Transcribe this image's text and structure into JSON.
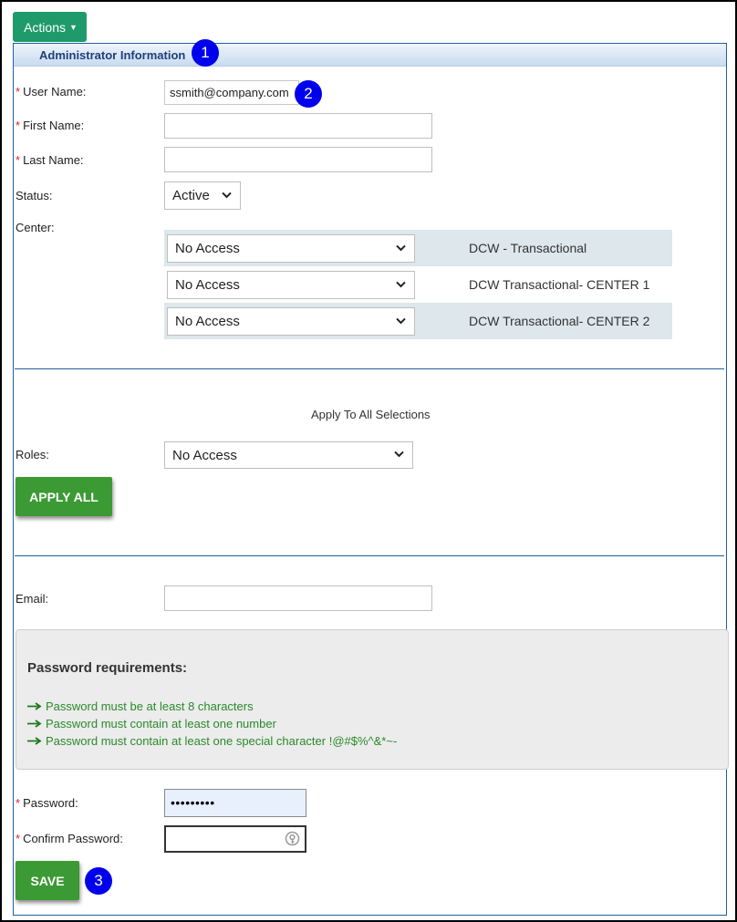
{
  "toolbar": {
    "actions_label": "Actions",
    "actions_caret": "▼"
  },
  "panel": {
    "title": "Administrator Information"
  },
  "callouts": {
    "one": "1",
    "two": "2",
    "three": "3"
  },
  "form": {
    "required_mark": "*",
    "username": {
      "label": "User Name:",
      "value": "ssmith@company.com"
    },
    "first_name": {
      "label": "First Name:",
      "value": ""
    },
    "last_name": {
      "label": "Last Name:",
      "value": ""
    },
    "status": {
      "label": "Status:",
      "value": "Active"
    },
    "center": {
      "label": "Center:",
      "rows": [
        {
          "access": "No Access",
          "name": "DCW - Transactional"
        },
        {
          "access": "No Access",
          "name": "DCW Transactional- CENTER 1"
        },
        {
          "access": "No Access",
          "name": "DCW Transactional- CENTER 2"
        }
      ]
    },
    "apply_all_heading": "Apply To All Selections",
    "roles": {
      "label": "Roles:",
      "value": "No Access"
    },
    "apply_all_button": "APPLY ALL",
    "email": {
      "label": "Email:",
      "value": ""
    },
    "password_requirements": {
      "title": "Password requirements:",
      "items": [
        "Password must be at least 8 characters",
        "Password must contain at least one number",
        "Password must contain at least one special character !@#$%^&*~-"
      ]
    },
    "password": {
      "label": "Password:",
      "value": "•••••••••"
    },
    "confirm_password": {
      "label": "Confirm Password:",
      "value": ""
    },
    "save_button": "SAVE"
  },
  "icons": {
    "chevron": "chevron-down-icon",
    "arrow": "arrow-right-icon",
    "key": "password-manager-key-icon"
  }
}
